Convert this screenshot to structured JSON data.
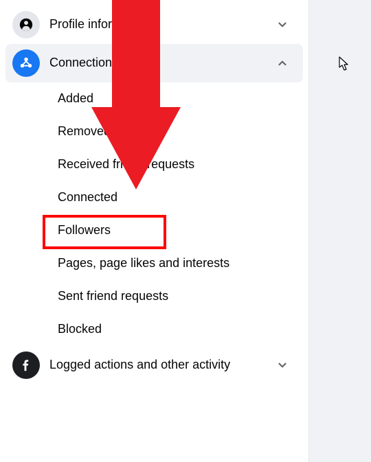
{
  "menu": {
    "profile": {
      "label": "Profile information"
    },
    "connections": {
      "label": "Connections"
    },
    "logged": {
      "label": "Logged actions and other activity"
    }
  },
  "sub": {
    "added": "Added",
    "removed": "Removed",
    "received": "Received friend requests",
    "connected": "Connected",
    "followers": "Followers",
    "pages": "Pages, page likes and interests",
    "sent": "Sent friend requests",
    "blocked": "Blocked"
  }
}
